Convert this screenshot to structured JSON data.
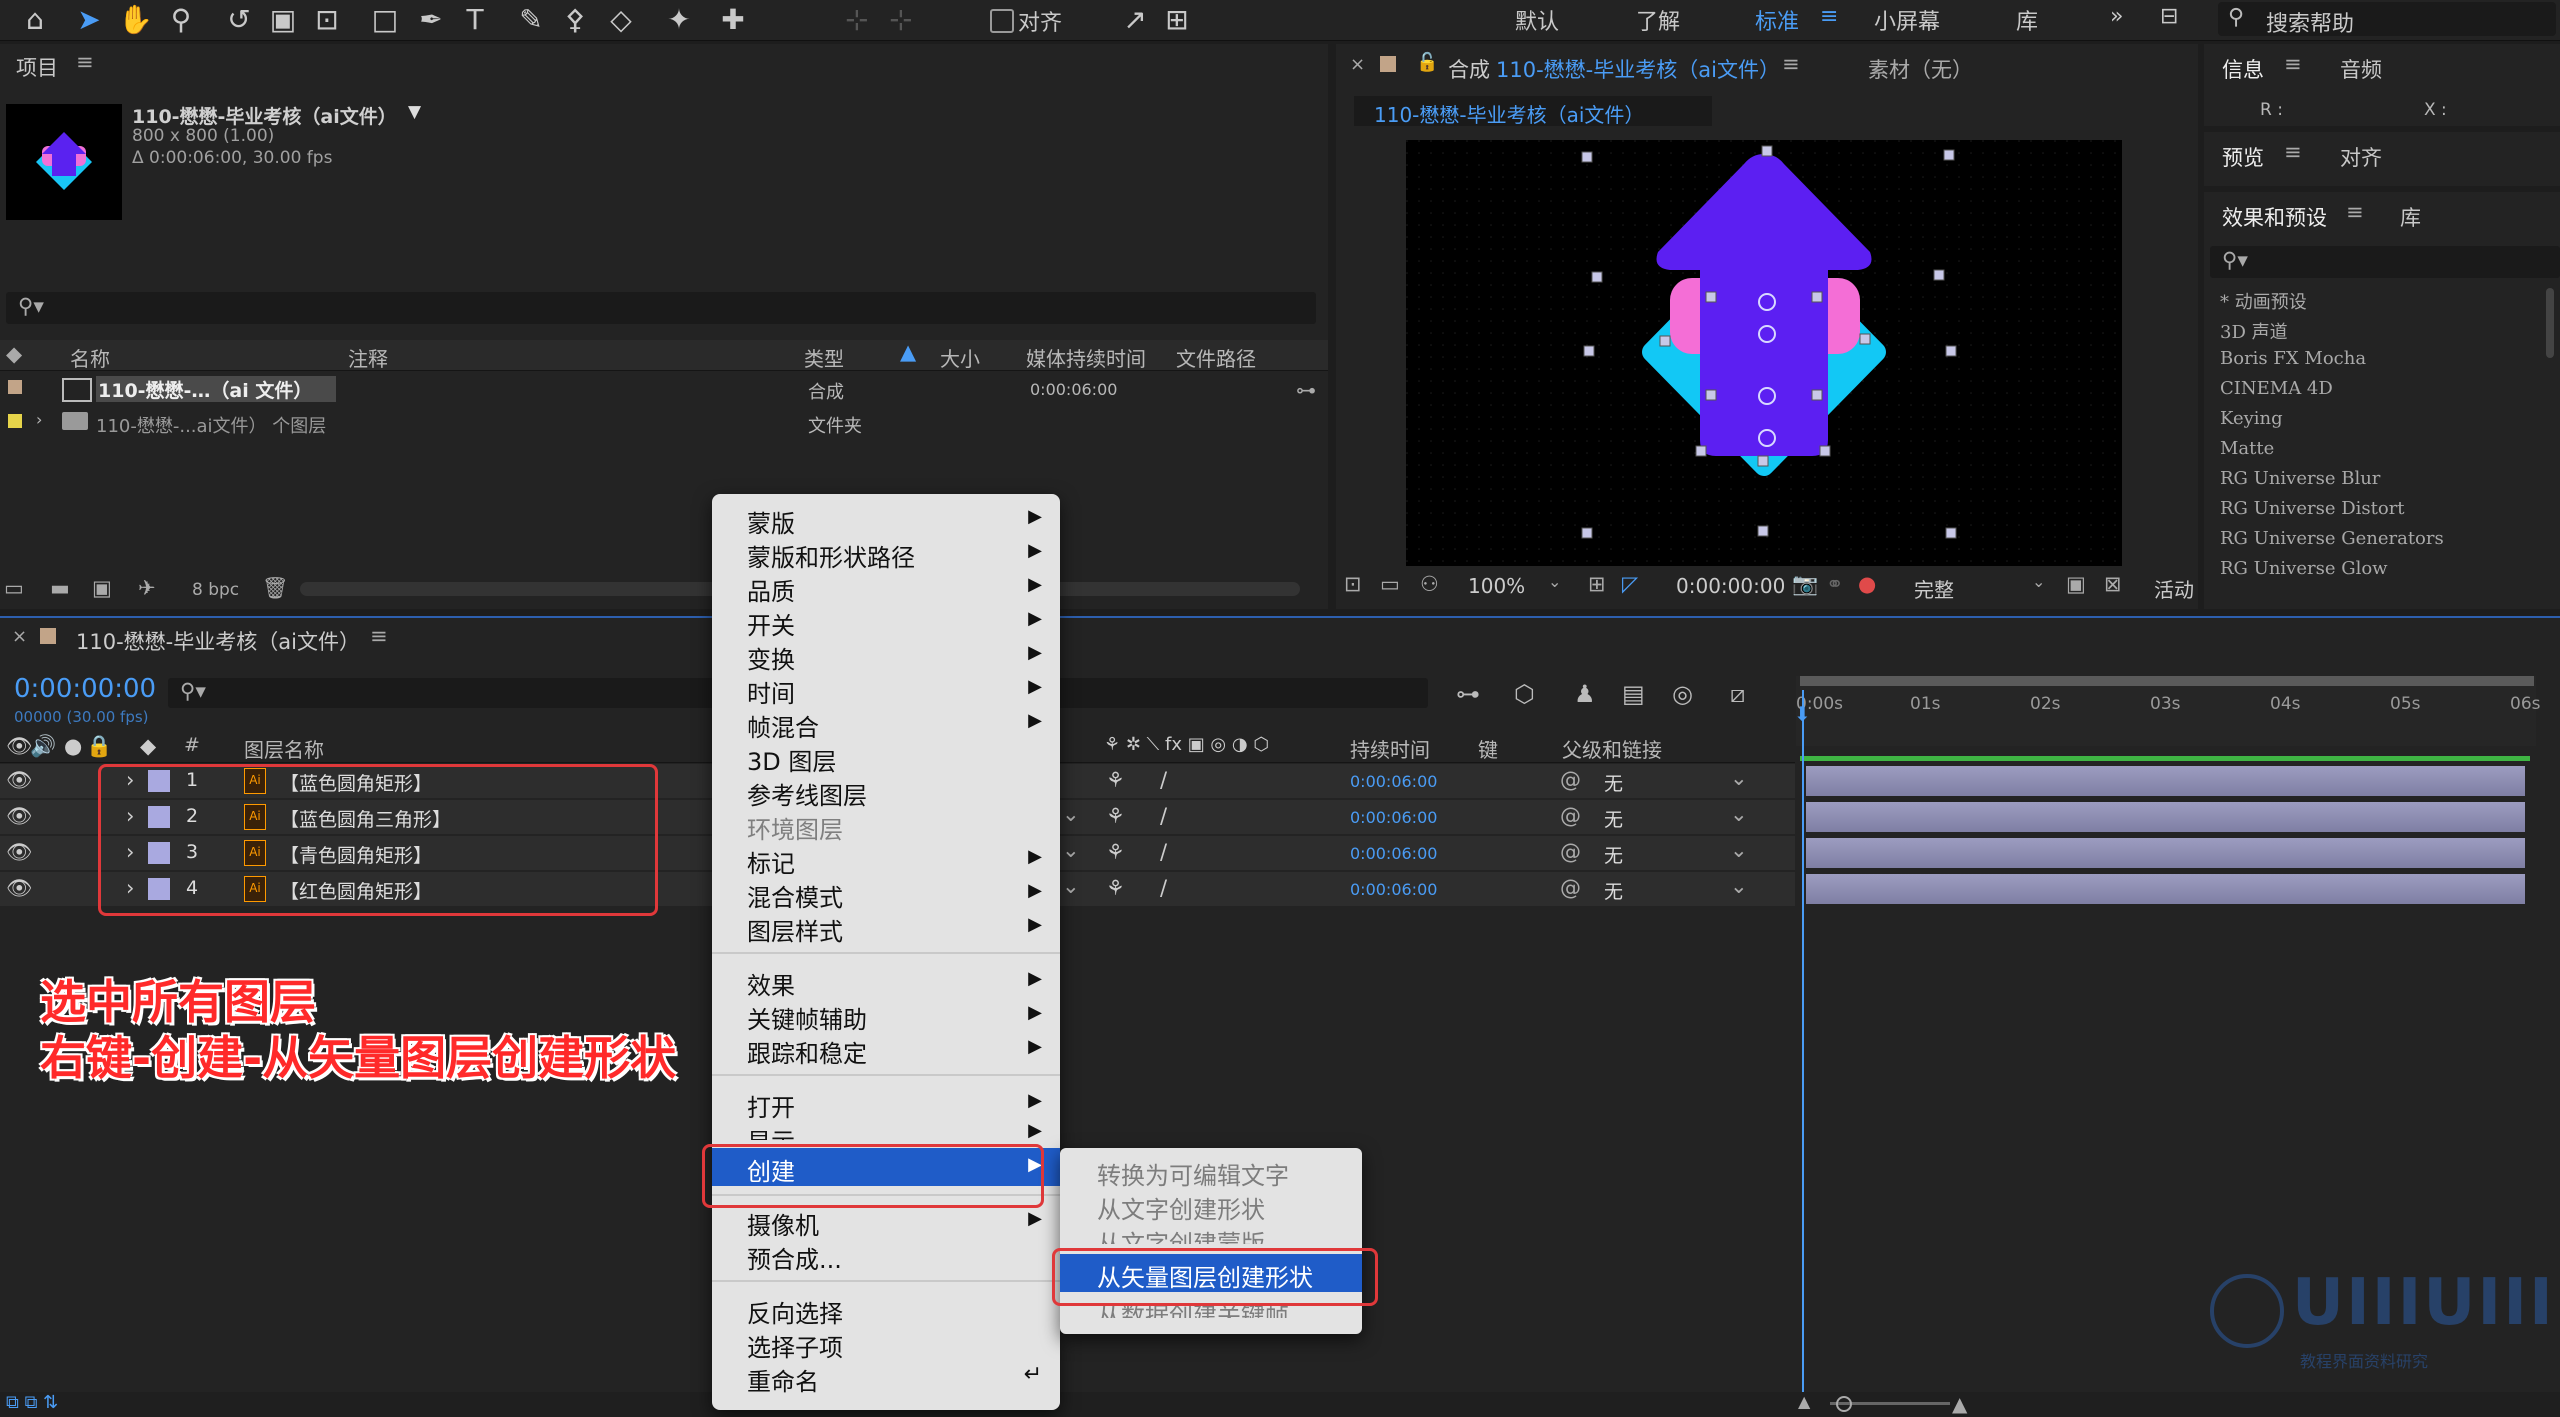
{
  "toolbar": {
    "align_label": "对齐",
    "workspaces": [
      "默认",
      "了解",
      "标准",
      "小屏幕",
      "库"
    ],
    "active_workspace": "标准",
    "search_help_placeholder": "搜索帮助"
  },
  "project_panel": {
    "title": "项目",
    "comp_name": "110-懋懋-毕业考核（ai文件）",
    "comp_size": "800 x 800 (1.00)",
    "comp_duration": "Δ 0:00:06:00, 30.00 fps",
    "columns": [
      "名称",
      "注释",
      "类型",
      "大小",
      "媒体持续时间",
      "文件路径"
    ],
    "rows": [
      {
        "name": "110-懋懋-…（ai 文件）",
        "type": "合成",
        "duration": "0:00:06:00"
      },
      {
        "name": "110-懋懋-...ai文件） 个图层",
        "type": "文件夹",
        "duration": ""
      }
    ],
    "bpc": "8 bpc"
  },
  "comp_viewer": {
    "tab_prefix": "合成",
    "tab_name": "110-懋懋-毕业考核（ai文件）",
    "footage_tab": "素材（无）",
    "breadcrumb": "110-懋懋-毕业考核（ai文件）",
    "zoom": "100%",
    "timecode": "0:00:00:00",
    "quality": "完整",
    "active_label": "活动"
  },
  "right_panels": {
    "info_tab": "信息",
    "audio_tab": "音频",
    "r_label": "R :",
    "x_label": "X :",
    "preview_tab": "预览",
    "align_tab": "对齐",
    "effects_tab": "效果和预设",
    "library_tab": "库",
    "effects": [
      "* 动画预设",
      "3D 声道",
      "Boris FX Mocha",
      "CINEMA 4D",
      "Keying",
      "Matte",
      "RG Universe Blur",
      "RG Universe Distort",
      "RG Universe Generators",
      "RG Universe Glow"
    ]
  },
  "timeline": {
    "comp_tab": "110-懋懋-毕业考核（ai文件）",
    "timecode": "0:00:00:00",
    "frames": "00000 (30.00 fps)",
    "col_layer_name": "图层名称",
    "col_hash": "#",
    "col_duration": "持续时间",
    "col_key": "键",
    "col_parent": "父级和链接",
    "ruler": [
      "0:00s",
      "01s",
      "02s",
      "03s",
      "04s",
      "05s",
      "06s"
    ],
    "layers": [
      {
        "num": "1",
        "name": "【蓝色圆角矩形】",
        "duration": "0:00:06:00",
        "parent": "无"
      },
      {
        "num": "2",
        "name": "【蓝色圆角三角形】",
        "duration": "0:00:06:00",
        "parent": "无"
      },
      {
        "num": "3",
        "name": "【青色圆角矩形】",
        "duration": "0:00:06:00",
        "parent": "无"
      },
      {
        "num": "4",
        "name": "【红色圆角矩形】",
        "duration": "0:00:06:00",
        "parent": "无"
      }
    ]
  },
  "annotation": {
    "line1": "选中所有图层",
    "line2": "右键-创建-从矢量图层创建形状"
  },
  "context_menu": {
    "items": [
      {
        "label": "蒙版",
        "arrow": true
      },
      {
        "label": "蒙版和形状路径",
        "arrow": true
      },
      {
        "label": "品质",
        "arrow": true
      },
      {
        "label": "开关",
        "arrow": true
      },
      {
        "label": "变换",
        "arrow": true
      },
      {
        "label": "时间",
        "arrow": true
      },
      {
        "label": "帧混合",
        "arrow": true
      },
      {
        "label": "3D 图层",
        "arrow": false
      },
      {
        "label": "参考线图层",
        "arrow": false
      },
      {
        "label": "环境图层",
        "arrow": false
      },
      {
        "label": "标记",
        "arrow": true
      },
      {
        "label": "混合模式",
        "arrow": true
      },
      {
        "label": "图层样式",
        "arrow": true
      },
      {
        "label": "效果",
        "arrow": true
      },
      {
        "label": "关键帧辅助",
        "arrow": true
      },
      {
        "label": "跟踪和稳定",
        "arrow": true
      },
      {
        "label": "打开",
        "arrow": true
      },
      {
        "label": "显示",
        "arrow": true
      },
      {
        "label": "创建",
        "arrow": true
      },
      {
        "label": "摄像机",
        "arrow": true
      },
      {
        "label": "预合成...",
        "arrow": false
      },
      {
        "label": "反向选择",
        "arrow": false
      },
      {
        "label": "选择子项",
        "arrow": false
      },
      {
        "label": "重命名",
        "arrow": false
      }
    ],
    "submenu": [
      {
        "label": "转换为可编辑文字"
      },
      {
        "label": "从文字创建形状"
      },
      {
        "label": "从文字创建蒙版"
      },
      {
        "label": "从矢量图层创建形状"
      },
      {
        "label": "从数据创建关键帧"
      }
    ]
  },
  "watermark": {
    "text": "UIIIUIII",
    "sub": "教程界面资料研究"
  },
  "colors": {
    "accent_blue": "#2d8ceb",
    "menu_highlight": "#1f5cc8",
    "red_annotation": "#e0383a",
    "layer_label": "#a9a9e0"
  }
}
